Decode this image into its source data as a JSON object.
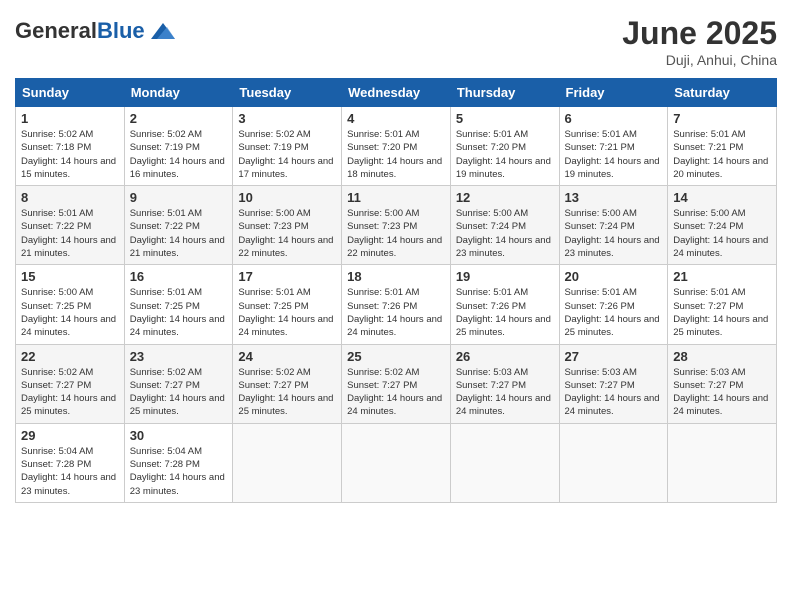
{
  "header": {
    "logo_general": "General",
    "logo_blue": "Blue",
    "month_year": "June 2025",
    "location": "Duji, Anhui, China"
  },
  "weekdays": [
    "Sunday",
    "Monday",
    "Tuesday",
    "Wednesday",
    "Thursday",
    "Friday",
    "Saturday"
  ],
  "weeks": [
    [
      {
        "day": "1",
        "sunrise": "5:02 AM",
        "sunset": "7:18 PM",
        "daylight": "14 hours and 15 minutes."
      },
      {
        "day": "2",
        "sunrise": "5:02 AM",
        "sunset": "7:19 PM",
        "daylight": "14 hours and 16 minutes."
      },
      {
        "day": "3",
        "sunrise": "5:02 AM",
        "sunset": "7:19 PM",
        "daylight": "14 hours and 17 minutes."
      },
      {
        "day": "4",
        "sunrise": "5:01 AM",
        "sunset": "7:20 PM",
        "daylight": "14 hours and 18 minutes."
      },
      {
        "day": "5",
        "sunrise": "5:01 AM",
        "sunset": "7:20 PM",
        "daylight": "14 hours and 19 minutes."
      },
      {
        "day": "6",
        "sunrise": "5:01 AM",
        "sunset": "7:21 PM",
        "daylight": "14 hours and 19 minutes."
      },
      {
        "day": "7",
        "sunrise": "5:01 AM",
        "sunset": "7:21 PM",
        "daylight": "14 hours and 20 minutes."
      }
    ],
    [
      {
        "day": "8",
        "sunrise": "5:01 AM",
        "sunset": "7:22 PM",
        "daylight": "14 hours and 21 minutes."
      },
      {
        "day": "9",
        "sunrise": "5:01 AM",
        "sunset": "7:22 PM",
        "daylight": "14 hours and 21 minutes."
      },
      {
        "day": "10",
        "sunrise": "5:00 AM",
        "sunset": "7:23 PM",
        "daylight": "14 hours and 22 minutes."
      },
      {
        "day": "11",
        "sunrise": "5:00 AM",
        "sunset": "7:23 PM",
        "daylight": "14 hours and 22 minutes."
      },
      {
        "day": "12",
        "sunrise": "5:00 AM",
        "sunset": "7:24 PM",
        "daylight": "14 hours and 23 minutes."
      },
      {
        "day": "13",
        "sunrise": "5:00 AM",
        "sunset": "7:24 PM",
        "daylight": "14 hours and 23 minutes."
      },
      {
        "day": "14",
        "sunrise": "5:00 AM",
        "sunset": "7:24 PM",
        "daylight": "14 hours and 24 minutes."
      }
    ],
    [
      {
        "day": "15",
        "sunrise": "5:00 AM",
        "sunset": "7:25 PM",
        "daylight": "14 hours and 24 minutes."
      },
      {
        "day": "16",
        "sunrise": "5:01 AM",
        "sunset": "7:25 PM",
        "daylight": "14 hours and 24 minutes."
      },
      {
        "day": "17",
        "sunrise": "5:01 AM",
        "sunset": "7:25 PM",
        "daylight": "14 hours and 24 minutes."
      },
      {
        "day": "18",
        "sunrise": "5:01 AM",
        "sunset": "7:26 PM",
        "daylight": "14 hours and 24 minutes."
      },
      {
        "day": "19",
        "sunrise": "5:01 AM",
        "sunset": "7:26 PM",
        "daylight": "14 hours and 25 minutes."
      },
      {
        "day": "20",
        "sunrise": "5:01 AM",
        "sunset": "7:26 PM",
        "daylight": "14 hours and 25 minutes."
      },
      {
        "day": "21",
        "sunrise": "5:01 AM",
        "sunset": "7:27 PM",
        "daylight": "14 hours and 25 minutes."
      }
    ],
    [
      {
        "day": "22",
        "sunrise": "5:02 AM",
        "sunset": "7:27 PM",
        "daylight": "14 hours and 25 minutes."
      },
      {
        "day": "23",
        "sunrise": "5:02 AM",
        "sunset": "7:27 PM",
        "daylight": "14 hours and 25 minutes."
      },
      {
        "day": "24",
        "sunrise": "5:02 AM",
        "sunset": "7:27 PM",
        "daylight": "14 hours and 25 minutes."
      },
      {
        "day": "25",
        "sunrise": "5:02 AM",
        "sunset": "7:27 PM",
        "daylight": "14 hours and 24 minutes."
      },
      {
        "day": "26",
        "sunrise": "5:03 AM",
        "sunset": "7:27 PM",
        "daylight": "14 hours and 24 minutes."
      },
      {
        "day": "27",
        "sunrise": "5:03 AM",
        "sunset": "7:27 PM",
        "daylight": "14 hours and 24 minutes."
      },
      {
        "day": "28",
        "sunrise": "5:03 AM",
        "sunset": "7:27 PM",
        "daylight": "14 hours and 24 minutes."
      }
    ],
    [
      {
        "day": "29",
        "sunrise": "5:04 AM",
        "sunset": "7:28 PM",
        "daylight": "14 hours and 23 minutes."
      },
      {
        "day": "30",
        "sunrise": "5:04 AM",
        "sunset": "7:28 PM",
        "daylight": "14 hours and 23 minutes."
      },
      null,
      null,
      null,
      null,
      null
    ]
  ]
}
